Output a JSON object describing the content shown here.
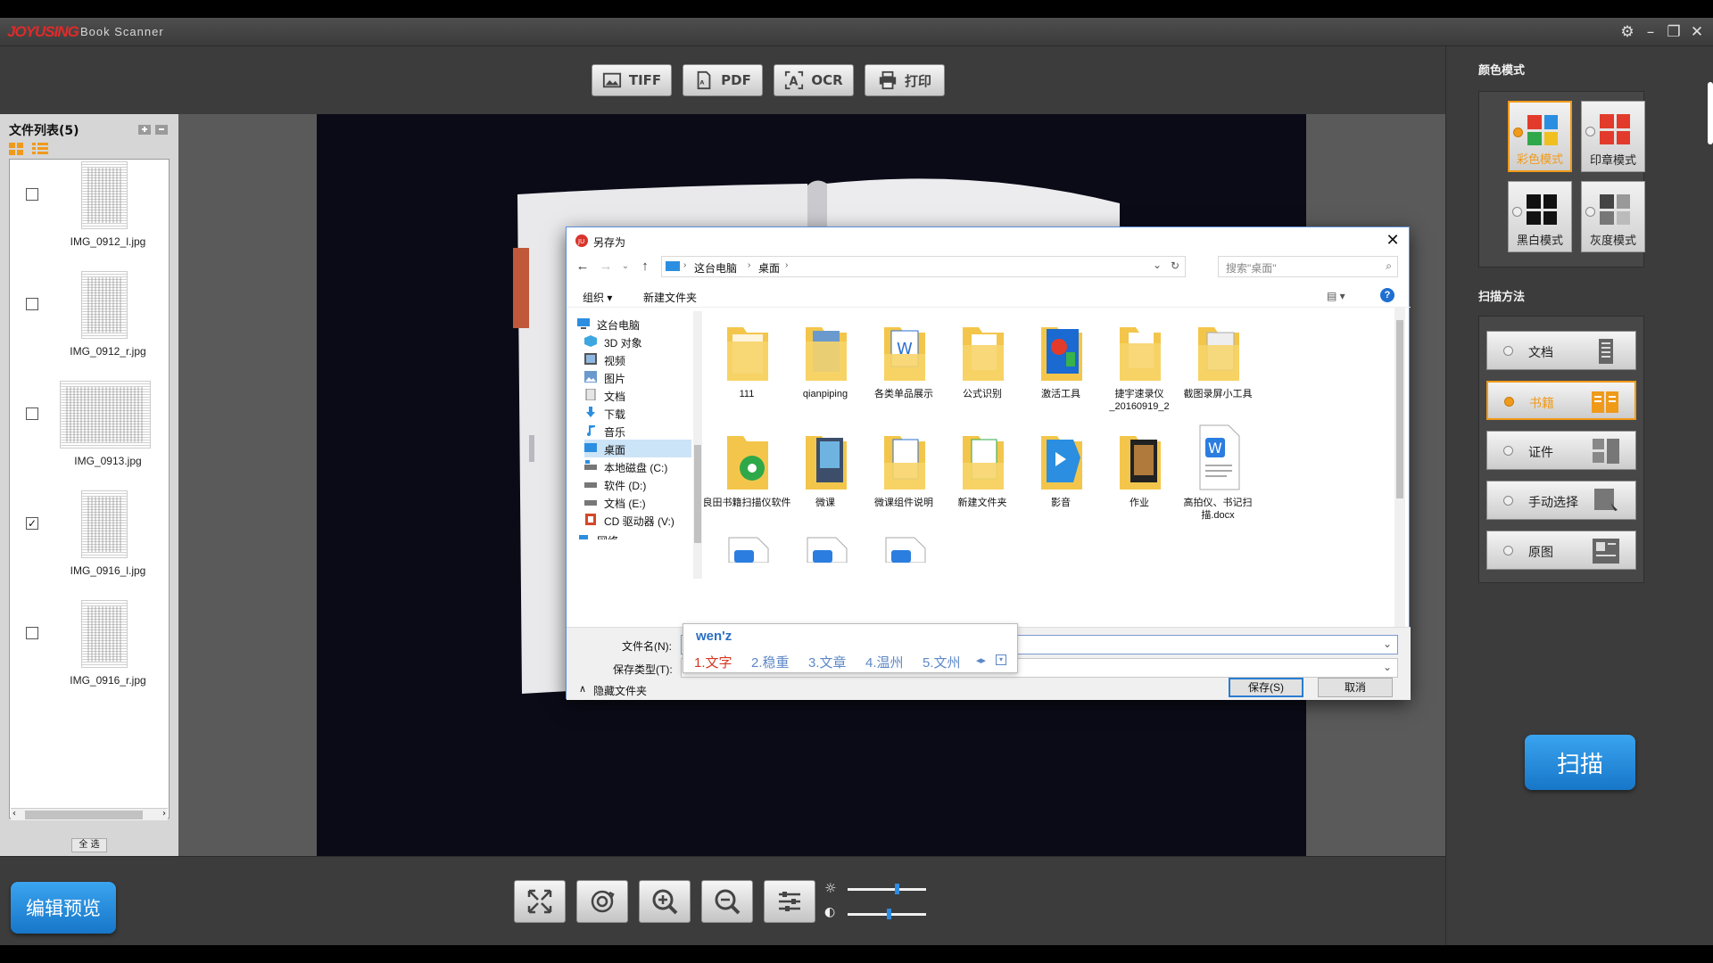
{
  "app": {
    "logo_text": "JOYUSING",
    "title": "Book Scanner"
  },
  "toolbar": {
    "tiff": "TIFF",
    "pdf": "PDF",
    "ocr": "OCR",
    "print": "打印"
  },
  "file_list": {
    "title": "文件列表(5)",
    "items": [
      {
        "name": "IMG_0912_l.jpg",
        "checked": false
      },
      {
        "name": "IMG_0912_r.jpg",
        "checked": false
      },
      {
        "name": "IMG_0913.jpg",
        "checked": false
      },
      {
        "name": "IMG_0916_l.jpg",
        "checked": true
      },
      {
        "name": "IMG_0916_r.jpg",
        "checked": false
      }
    ],
    "select_all": "全 选"
  },
  "color_mode": {
    "title": "颜色模式",
    "options": [
      {
        "label": "彩色模式",
        "active": true
      },
      {
        "label": "印章模式",
        "active": false
      },
      {
        "label": "黑白模式",
        "active": false
      },
      {
        "label": "灰度模式",
        "active": false
      }
    ]
  },
  "scan_method": {
    "title": "扫描方法",
    "options": [
      {
        "label": "文档",
        "active": false
      },
      {
        "label": "书籍",
        "active": true
      },
      {
        "label": "证件",
        "active": false
      },
      {
        "label": "手动选择",
        "active": false
      },
      {
        "label": "原图",
        "active": false
      }
    ]
  },
  "scan_button": "扫描",
  "edit_preview": "编辑预览",
  "dialog": {
    "title": "另存为",
    "breadcrumbs": [
      "这台电脑",
      "桌面"
    ],
    "search_placeholder": "搜索\"桌面\"",
    "organize": "组织 ▾",
    "new_folder": "新建文件夹",
    "nav_items": [
      {
        "label": "这台电脑",
        "selected": false
      },
      {
        "label": "3D 对象",
        "selected": false
      },
      {
        "label": "视频",
        "selected": false
      },
      {
        "label": "图片",
        "selected": false
      },
      {
        "label": "文档",
        "selected": false
      },
      {
        "label": "下载",
        "selected": false
      },
      {
        "label": "音乐",
        "selected": false
      },
      {
        "label": "桌面",
        "selected": true
      },
      {
        "label": "本地磁盘 (C:)",
        "selected": false
      },
      {
        "label": "软件 (D:)",
        "selected": false
      },
      {
        "label": "文档 (E:)",
        "selected": false
      },
      {
        "label": "CD 驱动器 (V:)",
        "selected": false
      },
      {
        "label": "网络",
        "selected": false
      }
    ],
    "files": [
      {
        "label": "111",
        "kind": "folder"
      },
      {
        "label": "qianpiping",
        "kind": "folder"
      },
      {
        "label": "各类单品展示",
        "kind": "folder"
      },
      {
        "label": "公式识别",
        "kind": "folder"
      },
      {
        "label": "激活工具",
        "kind": "folder"
      },
      {
        "label": "捷宇速录仪_20160919_2",
        "kind": "folder"
      },
      {
        "label": "截图录屏小工具",
        "kind": "folder"
      },
      {
        "label": "良田书籍扫描仪软件",
        "kind": "folder"
      },
      {
        "label": "微课",
        "kind": "folder"
      },
      {
        "label": "微课组件说明",
        "kind": "folder"
      },
      {
        "label": "新建文件夹",
        "kind": "folder"
      },
      {
        "label": "影音",
        "kind": "folder"
      },
      {
        "label": "作业",
        "kind": "folder"
      },
      {
        "label": "高拍仪、书记扫描.docx",
        "kind": "docx"
      }
    ],
    "filename_label": "文件名(N):",
    "filename_value": "",
    "filetype_label": "保存类型(T):",
    "hide_folders": "隐藏文件夹",
    "save": "保存(S)",
    "cancel": "取消"
  },
  "ime": {
    "pinyin": "wen'z",
    "candidates": [
      "1.文字",
      "2.稳重",
      "3.文章",
      "4.温州",
      "5.文州"
    ]
  },
  "sliders": {
    "brightness": 0.6,
    "contrast": 0.5
  }
}
